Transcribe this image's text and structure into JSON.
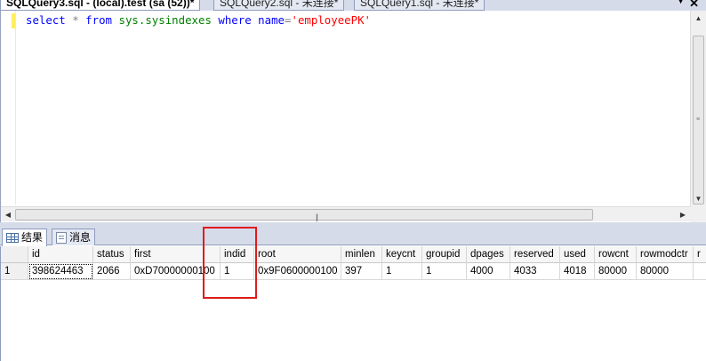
{
  "tabs": [
    {
      "label": "SQLQuery3.sql - (local).test (sa (52))*"
    },
    {
      "label": "SQLQuery2.sql - 未连接*"
    },
    {
      "label": "SQLQuery1.sql - 未连接*"
    }
  ],
  "tab_controls": {
    "dropdown_icon": "chevron-down-icon",
    "close_icon": "close-icon"
  },
  "editor": {
    "tokens": {
      "t1": "select",
      "t2": "*",
      "t3": "from",
      "t4": "sys.sysindexes",
      "t5": "where",
      "t6": "name",
      "t7": "=",
      "t8": "'employeePK'"
    }
  },
  "result_tabs": [
    {
      "label": "结果",
      "icon": "grid-icon"
    },
    {
      "label": "消息",
      "icon": "message-icon"
    }
  ],
  "results": {
    "columns": [
      "",
      "id",
      "status",
      "first",
      "indid",
      "root",
      "minlen",
      "keycnt",
      "groupid",
      "dpages",
      "reserved",
      "used",
      "rowcnt",
      "rowmodctr",
      "r"
    ],
    "rows": [
      [
        "1",
        "398624463",
        "2066",
        "0xD70000000100",
        "1",
        "0x9F0600000100",
        "397",
        "1",
        "1",
        "4000",
        "4033",
        "4018",
        "80000",
        "80000",
        ""
      ]
    ]
  },
  "colors": {
    "keyword": "#0000ff",
    "string": "#ff0000",
    "highlight": "#e01b1b"
  }
}
